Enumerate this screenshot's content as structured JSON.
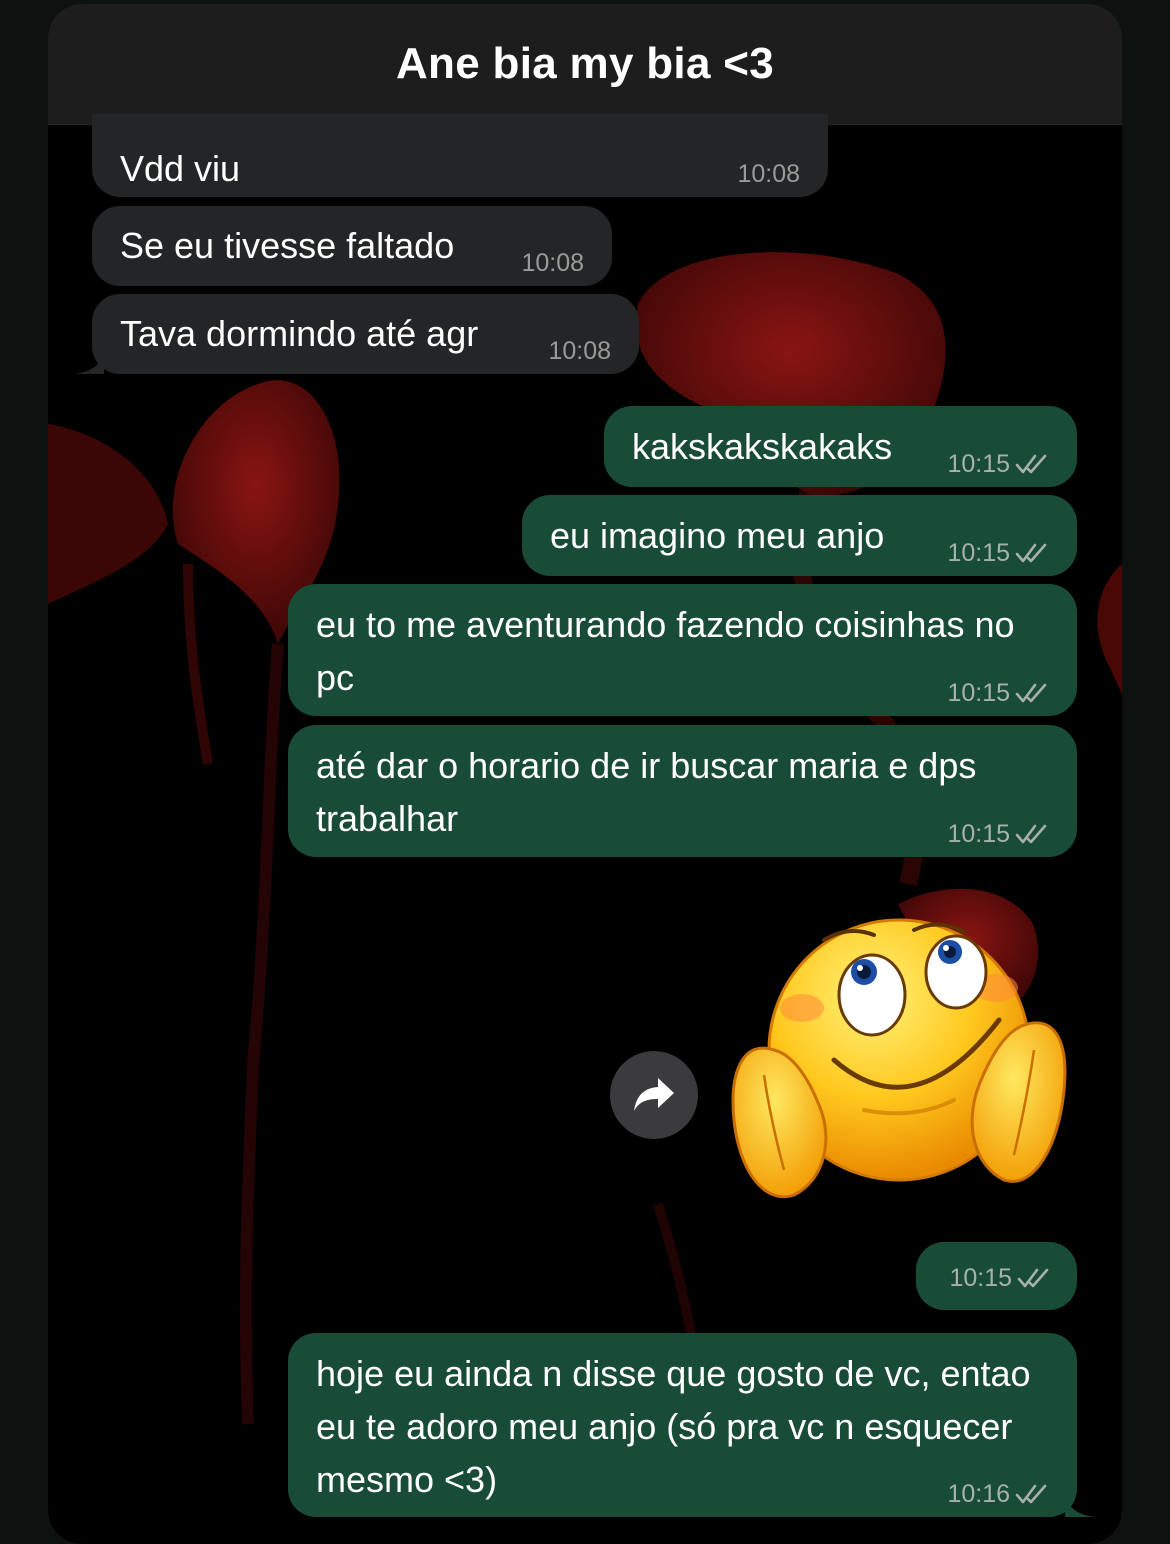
{
  "chat": {
    "title": "Ane bia my bia <3"
  },
  "messages": [
    {
      "dir": "in",
      "text": "Vdd viu",
      "time": "10:08"
    },
    {
      "dir": "in",
      "text": "Se eu tivesse faltado",
      "time": "10:08"
    },
    {
      "dir": "in",
      "text": "Tava dormindo até agr",
      "time": "10:08"
    },
    {
      "dir": "out",
      "text": "kakskakskakaks",
      "time": "10:15",
      "status": "read"
    },
    {
      "dir": "out",
      "text": "eu imagino meu anjo",
      "time": "10:15",
      "status": "read"
    },
    {
      "dir": "out",
      "text": "eu to me aventurando fazendo coisinhas no pc",
      "time": "10:15",
      "status": "read"
    },
    {
      "dir": "out",
      "text": "até dar o horario de ir buscar maria e dps trabalhar",
      "time": "10:15",
      "status": "read"
    },
    {
      "dir": "out",
      "type": "sticker",
      "sticker": "smiley-hands-on-cheeks-looking-up",
      "time": "10:15",
      "status": "read"
    },
    {
      "dir": "out",
      "text": "hoje eu ainda n disse que gosto de vc, entao eu te adoro meu anjo (só pra vc n esquecer mesmo <3)",
      "time": "10:16",
      "status": "read"
    }
  ],
  "icons": {
    "forward": "forward-arrow-icon",
    "read_receipt": "double-check-icon"
  },
  "colors": {
    "header_bg": "#1d1d1d",
    "incoming_bubble": "#242526",
    "outgoing_bubble": "#184c37",
    "wallpaper_accent": "#7a1210"
  }
}
